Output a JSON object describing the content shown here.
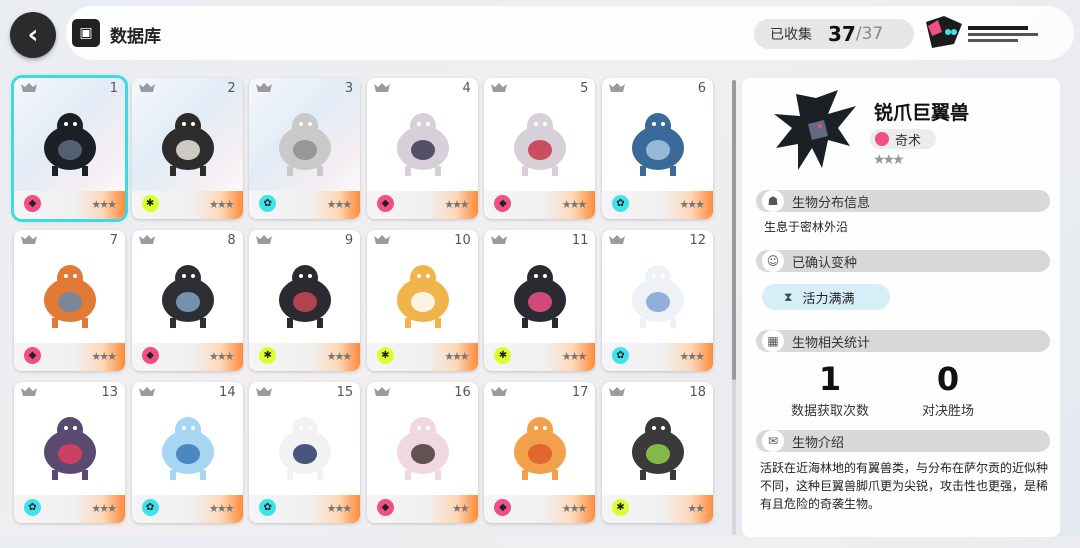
{
  "header": {
    "title": "数据库",
    "collected_label": "已收集",
    "collected_count": "37",
    "collected_total": "/37"
  },
  "colors": {
    "selection": "#3fd8e3",
    "pink": "#ef4f86",
    "lime": "#d9ff2f",
    "cyan": "#3de2ec"
  },
  "cards": [
    {
      "num": "1",
      "type": "pink",
      "stars": "★★★",
      "holo": true,
      "selected": true,
      "icon": "dark-dragon-icon"
    },
    {
      "num": "2",
      "type": "lime",
      "stars": "★★★",
      "holo": true,
      "selected": false,
      "icon": "hooded-man-icon"
    },
    {
      "num": "3",
      "type": "cyan",
      "stars": "★★★",
      "holo": true,
      "selected": false,
      "icon": "statue-icon"
    },
    {
      "num": "4",
      "type": "pink",
      "stars": "★★★",
      "holo": false,
      "selected": false,
      "icon": "wizard-sheep-icon"
    },
    {
      "num": "5",
      "type": "pink",
      "stars": "★★★",
      "holo": false,
      "selected": false,
      "icon": "red-wizard-sheep-icon"
    },
    {
      "num": "6",
      "type": "cyan",
      "stars": "★★★",
      "holo": false,
      "selected": false,
      "icon": "blue-dragon-icon"
    },
    {
      "num": "7",
      "type": "pink",
      "stars": "★★★",
      "holo": false,
      "selected": false,
      "icon": "orange-dragon-icon"
    },
    {
      "num": "8",
      "type": "pink",
      "stars": "★★★",
      "holo": false,
      "selected": false,
      "icon": "mushroom-creature-icon"
    },
    {
      "num": "9",
      "type": "lime",
      "stars": "★★★",
      "holo": false,
      "selected": false,
      "icon": "spider-icon"
    },
    {
      "num": "10",
      "type": "lime",
      "stars": "★★★",
      "holo": false,
      "selected": false,
      "icon": "cat-icon"
    },
    {
      "num": "11",
      "type": "lime",
      "stars": "★★★",
      "holo": false,
      "selected": false,
      "icon": "rock-golem-icon"
    },
    {
      "num": "12",
      "type": "cyan",
      "stars": "★★★",
      "holo": false,
      "selected": false,
      "icon": "white-cat-icon"
    },
    {
      "num": "13",
      "type": "cyan",
      "stars": "★★★",
      "holo": false,
      "selected": false,
      "icon": "purple-beast-icon"
    },
    {
      "num": "14",
      "type": "cyan",
      "stars": "★★★",
      "holo": false,
      "selected": false,
      "icon": "pixel-ghost-icon"
    },
    {
      "num": "15",
      "type": "cyan",
      "stars": "★★★",
      "holo": false,
      "selected": false,
      "icon": "skeleton-icon"
    },
    {
      "num": "16",
      "type": "pink",
      "stars": "★★",
      "holo": false,
      "selected": false,
      "icon": "fluffy-sheep-icon"
    },
    {
      "num": "17",
      "type": "pink",
      "stars": "★★★",
      "holo": false,
      "selected": false,
      "icon": "fire-fox-icon"
    },
    {
      "num": "18",
      "type": "lime",
      "stars": "★★",
      "holo": false,
      "selected": false,
      "icon": "mossy-beast-icon"
    }
  ],
  "detail": {
    "name": "锐爪巨翼兽",
    "type_label": "奇术",
    "stars": "★★★",
    "dist_title": "生物分布信息",
    "dist_text": "生息于密林外沿",
    "variant_title": "已确认变种",
    "variant_label": "活力满满",
    "stats_title": "生物相关统计",
    "stat1_value": "1",
    "stat1_label": "数据获取次数",
    "stat2_value": "0",
    "stat2_label": "对决胜场",
    "intro_title": "生物介绍",
    "intro_text": "活跃在近海林地的有翼兽类，与分布在萨尔贡的近似种不同，这种巨翼兽脚爪更为尖锐，攻击性也更强，是稀有且危险的奇袭生物。"
  }
}
